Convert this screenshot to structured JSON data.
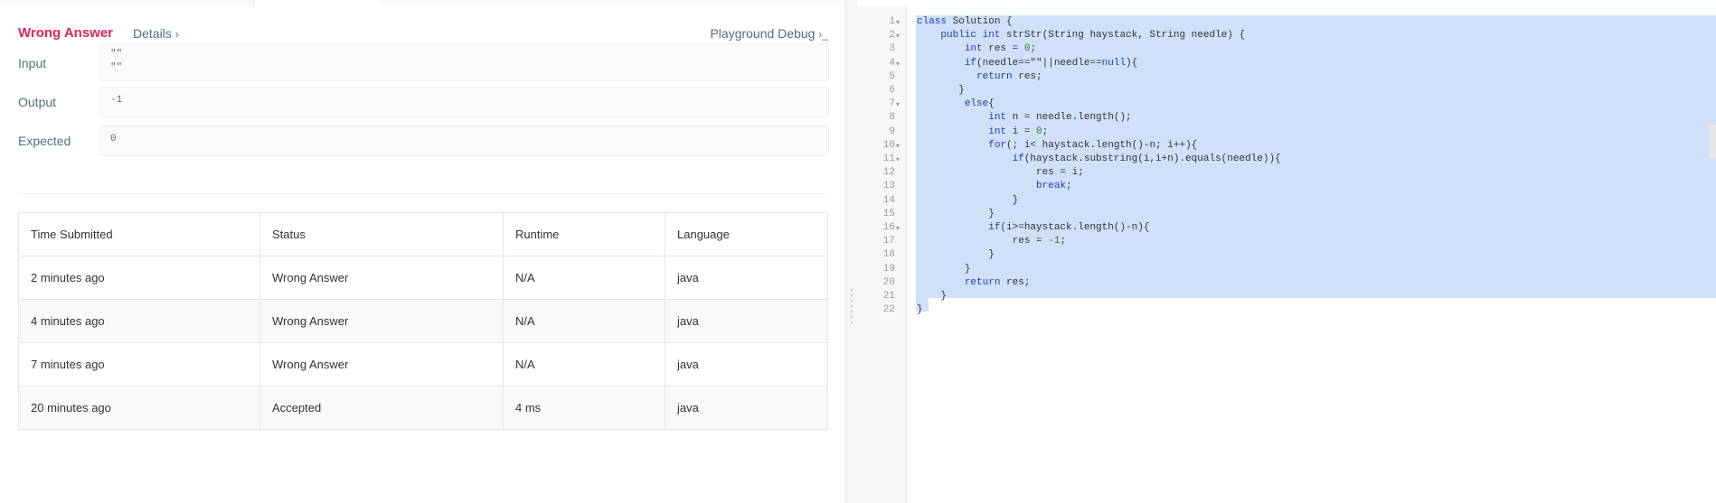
{
  "result": {
    "verdict": "Wrong Answer",
    "details_label": "Details",
    "playground_label": "Playground Debug",
    "io": [
      {
        "label": "Input",
        "lines": [
          "\"\"",
          "\"\""
        ]
      },
      {
        "label": "Output",
        "lines": [
          "-1"
        ]
      },
      {
        "label": "Expected",
        "lines": [
          "0"
        ]
      }
    ]
  },
  "submissions": {
    "headers": [
      "Time Submitted",
      "Status",
      "Runtime",
      "Language"
    ],
    "rows": [
      {
        "time": "2 minutes ago",
        "status": "Wrong Answer",
        "runtime": "N/A",
        "language": "java"
      },
      {
        "time": "4 minutes ago",
        "status": "Wrong Answer",
        "runtime": "N/A",
        "language": "java"
      },
      {
        "time": "7 minutes ago",
        "status": "Wrong Answer",
        "runtime": "N/A",
        "language": "java"
      },
      {
        "time": "20 minutes ago",
        "status": "Accepted",
        "runtime": "4 ms",
        "language": "java"
      }
    ]
  },
  "editor": {
    "lines": [
      "class Solution {",
      "    public int strStr(String haystack, String needle) {",
      "        int res = 0;",
      "        if(needle==\"\"||needle==null){",
      "          return res;",
      "       }",
      "        else{",
      "            int n = needle.length();",
      "            int i = 0;",
      "            for(; i< haystack.length()-n; i++){",
      "                if(haystack.substring(i,i+n).equals(needle)){",
      "                    res = i;",
      "                    break;",
      "                }",
      "            }",
      "            if(i>=haystack.length()-n){",
      "                res = -1;",
      "            }",
      "        }",
      "        return res;",
      "    }",
      "}"
    ],
    "foldable_lines": [
      1,
      2,
      4,
      7,
      10,
      11,
      16
    ]
  },
  "colors": {
    "wrong": "#d44a4a",
    "accepted": "#1d9a6c",
    "verdict": "#e0245e",
    "selection": "#cfe0f8"
  }
}
